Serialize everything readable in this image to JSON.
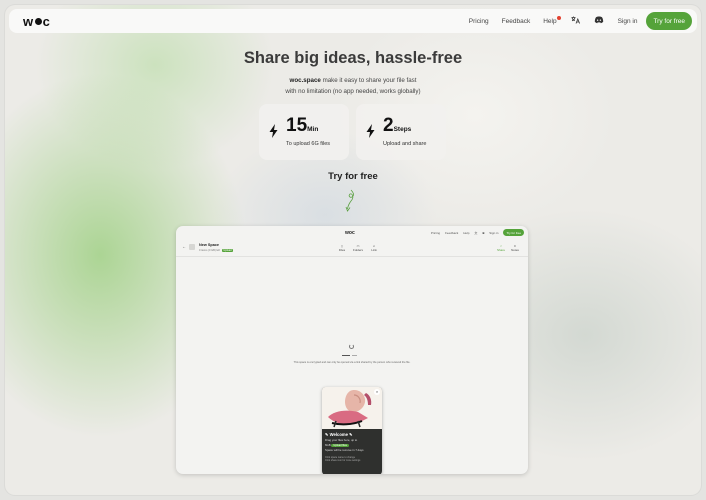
{
  "nav": {
    "logo": "woc",
    "links": [
      "Pricing",
      "Feedback",
      "Help"
    ],
    "icons": [
      "translate-icon",
      "discord-icon"
    ],
    "sign_in": "Sign in",
    "try_free": "Try for free"
  },
  "hero": {
    "headline": "Share big ideas, hassle-free",
    "sub_brand": "woc.space",
    "sub_line1": " make it easy to share your file fast",
    "sub_line2": "with no limitation (no app needed, works globally)",
    "stats": [
      {
        "big": "15",
        "unit": "Min",
        "caption": "To upload 6G files"
      },
      {
        "big": "2",
        "unit": "Steps",
        "caption": "Upload and share"
      }
    ],
    "try_label": "Try for free"
  },
  "preview": {
    "logo": "woc",
    "links": [
      "Pricing",
      "Feedback",
      "Help",
      "Sign in",
      "Try for free"
    ],
    "space_name": "New Space",
    "space_meta": "0 items (0 GB) left",
    "badge": "Upload",
    "tabs": [
      "Files",
      "Folders",
      "Link"
    ],
    "actions": [
      "Share",
      "Notes"
    ],
    "note": "This space is encrypted and can only be opened via a link shared by the person who received the file.",
    "card": {
      "title": "✎ Welcome ✎",
      "line1": "Drag your files here, up to",
      "line2_prefix": "6GB",
      "line2_button": "Upload files",
      "line3": "Space will be remove in 7 days",
      "small1": "Click space name to change",
      "small2": "Click share icon for more settings"
    }
  },
  "colors": {
    "accent": "#55a33a",
    "notify_dot": "#e3412f",
    "text_dark": "#3b3b3b"
  }
}
